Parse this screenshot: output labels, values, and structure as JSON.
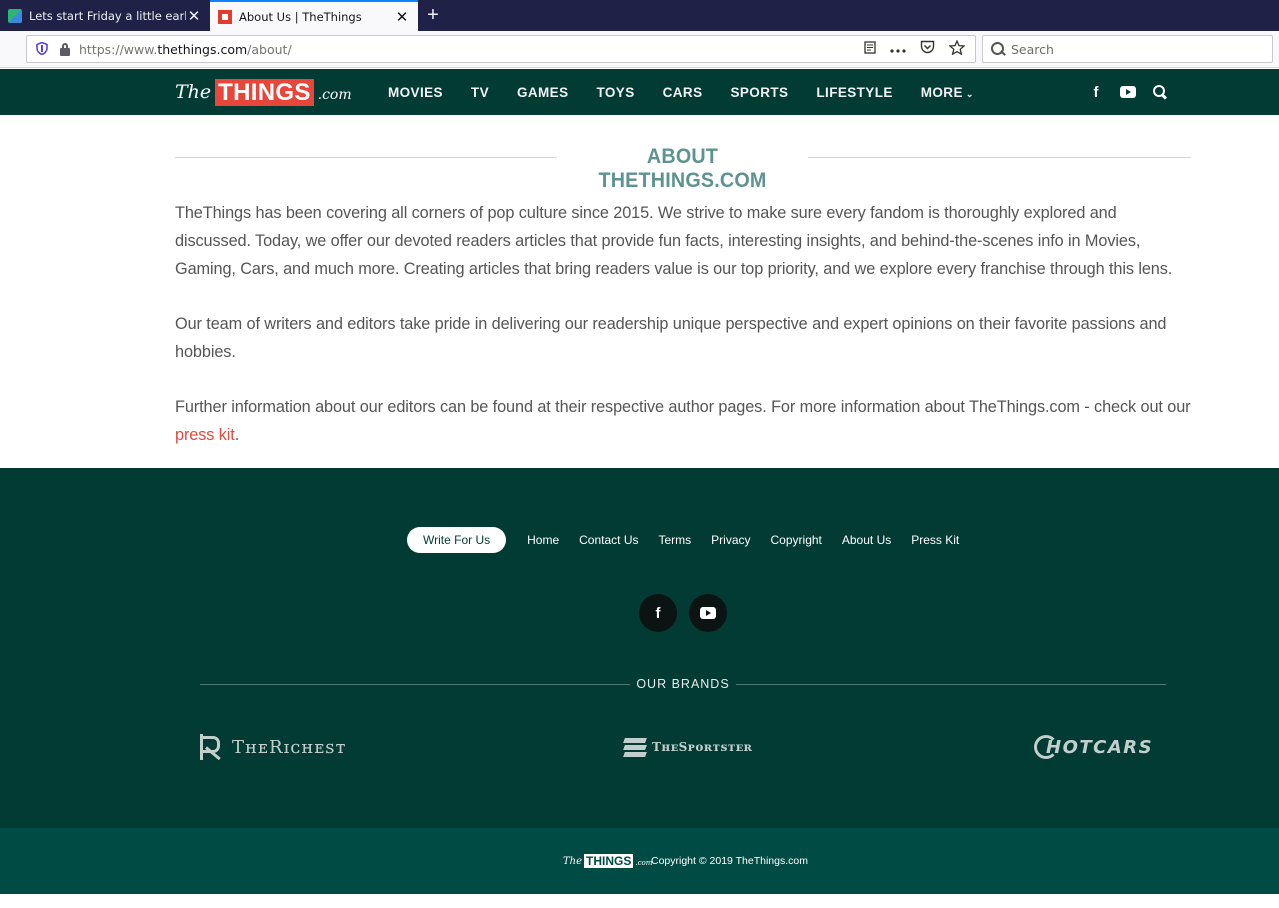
{
  "browser": {
    "tabs": [
      {
        "title": "Lets start Friday a little early! | T",
        "active": false
      },
      {
        "title": "About Us | TheThings",
        "active": true
      }
    ],
    "close_glyph": "✕",
    "new_tab_glyph": "+",
    "url_prefix": "https://www.",
    "url_domain": "thethings.com",
    "url_path": "/about/",
    "search_placeholder": "Search",
    "icons": [
      "tracking-shield-icon",
      "lock-icon",
      "reader-view-icon",
      "page-actions-icon",
      "pocket-icon",
      "bookmark-star-icon",
      "search-icon"
    ]
  },
  "site_header": {
    "logo": {
      "the": "The",
      "things": "THINGS",
      "com": ".com"
    },
    "nav": [
      "MOVIES",
      "TV",
      "GAMES",
      "TOYS",
      "CARS",
      "SPORTS",
      "LIFESTYLE"
    ],
    "more_label": "MORE",
    "more_caret": "⌄",
    "icons": [
      "facebook-icon",
      "youtube-icon",
      "search-icon"
    ],
    "facebook_glyph": "f"
  },
  "content": {
    "title": "ABOUT THETHINGS.COM",
    "paragraph1": "TheThings has been covering all corners of pop culture since 2015. We strive to make sure every fandom is thoroughly explored and discussed. Today, we offer our devoted readers articles that provide fun facts, interesting insights, and behind-the-scenes info in Movies, Gaming, Cars, and much more. Creating articles that bring readers value is our top priority, and we explore every franchise through this lens.",
    "paragraph2": "Our team of writers and editors take pride in delivering our readership unique perspective and expert opinions on their favorite passions and hobbies.",
    "paragraph3_text": "Further information about our editors can be found at their respective author pages. For more information about TheThings.com - check out our ",
    "paragraph3_link": "press kit",
    "paragraph3_end": "."
  },
  "footer": {
    "write_button": "Write For Us",
    "links": [
      "Home",
      "Contact Us",
      "Terms",
      "Privacy",
      "Copyright",
      "About Us",
      "Press Kit"
    ],
    "facebook_glyph": "f",
    "brands_label": "OUR BRANDS",
    "brands": [
      {
        "name": "TheRichest",
        "display": "TʜᴇRɪᴄʜᴇꜱᴛ"
      },
      {
        "name": "TheSportster",
        "display": "TʜᴇSᴘᴏʀᴛꜱᴛᴇʀ"
      },
      {
        "name": "HotCars",
        "display": "HOTCARS"
      }
    ],
    "mini_logo": {
      "the": "The",
      "things": "THINGS",
      "com": ".com"
    },
    "copyright": "Copyright © 2019 TheThings.com"
  },
  "colors": {
    "header_bg": "#023a34",
    "footer_bg": "#023a34",
    "bottom_bar_bg": "#014b45",
    "accent_red": "#e8463b",
    "title_teal": "#5d9391"
  }
}
